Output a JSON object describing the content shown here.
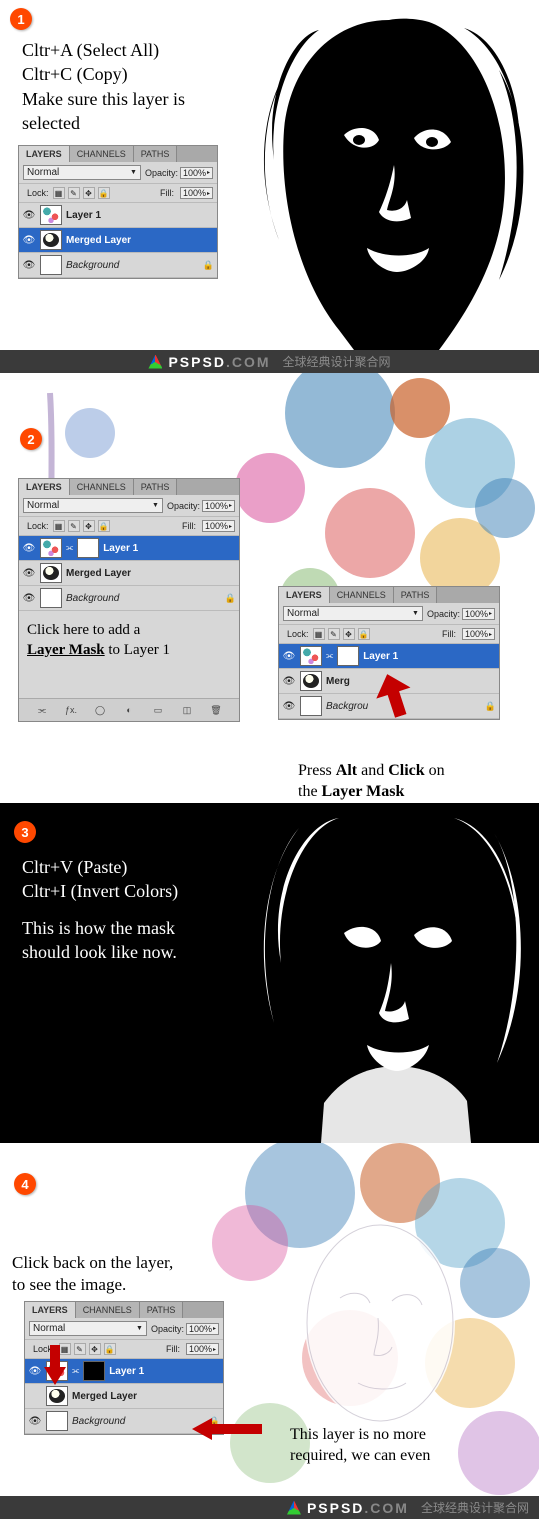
{
  "steps": {
    "s1": "1",
    "s2": "2",
    "s3": "3",
    "s4": "4"
  },
  "s1": {
    "line1": "Cltr+A (Select All)",
    "line2": "Cltr+C (Copy)",
    "line3": "Make sure this layer is",
    "line4": "selected"
  },
  "panel": {
    "tabs": {
      "layers": "LAYERS",
      "channels": "CHANNELS",
      "paths": "PATHS"
    },
    "blend": "Normal",
    "opacityLabel": "Opacity:",
    "opacityVal": "100%",
    "lockLabel": "Lock:",
    "fillLabel": "Fill:",
    "fillVal": "100%",
    "layers1": [
      {
        "name": "Layer 1",
        "sel": false,
        "thumb": "water"
      },
      {
        "name": "Merged Layer",
        "sel": true,
        "thumb": "face"
      },
      {
        "name": "Background",
        "sel": false,
        "thumb": "blank",
        "italic": true,
        "lock": true
      }
    ],
    "layers2a": [
      {
        "name": "Layer 1",
        "sel": true,
        "thumb": "water",
        "mask": "blank"
      },
      {
        "name": "Merged Layer",
        "sel": false,
        "thumb": "face"
      },
      {
        "name": "Background",
        "sel": false,
        "thumb": "blank",
        "italic": true,
        "lock": true
      }
    ],
    "layers2b": [
      {
        "name": "Layer 1",
        "sel": true,
        "thumb": "water",
        "mask": "blank"
      },
      {
        "name": "Merged Layer",
        "sel": false,
        "thumb": "face",
        "truncated": "Merg"
      },
      {
        "name": "Background",
        "sel": false,
        "thumb": "blank",
        "truncated": "Backgrou",
        "italic": true,
        "lock": true
      }
    ],
    "layers4": [
      {
        "name": "Layer 1",
        "sel": true,
        "thumb": "water",
        "mask": "blackmask"
      },
      {
        "name": "Merged Layer",
        "sel": false,
        "thumb": "face"
      },
      {
        "name": "Background",
        "sel": false,
        "thumb": "blank",
        "italic": true,
        "lock": true
      }
    ]
  },
  "s2": {
    "instr1": "Click here to add a",
    "instr2a": "Layer Mask",
    "instr2b": " to Layer 1",
    "cap1": "Press ",
    "capB1": "Alt",
    "cap2": " and ",
    "capB2": "Click",
    "cap3": " on",
    "cap4": "the ",
    "capB3": "Layer Mask"
  },
  "s3": {
    "line1": "Cltr+V (Paste)",
    "line2": "Cltr+I (Invert Colors)",
    "line3": "This is how the mask",
    "line4": "should look like now."
  },
  "s4": {
    "t1a": "Click back on the layer,",
    "t1b": "to see the image.",
    "t2a": "This layer is no more",
    "t2b": "required, we can even"
  },
  "sep": {
    "domain1": "PSPSD",
    "domain2": ".COM",
    "cn": "全球经典设计聚合网"
  }
}
